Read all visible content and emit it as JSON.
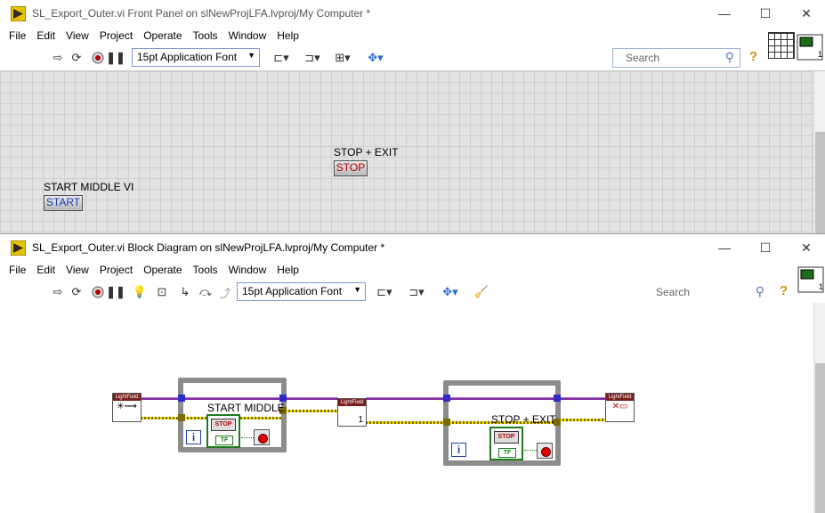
{
  "front_panel": {
    "title": "SL_Export_Outer.vi Front Panel on slNewProjLFA.lvproj/My Computer *",
    "menu": [
      "File",
      "Edit",
      "View",
      "Project",
      "Operate",
      "Tools",
      "Window",
      "Help"
    ],
    "font_select": "15pt Application Font",
    "search_placeholder": "Search",
    "controls": {
      "stop_exit_label": "STOP + EXIT",
      "stop_button_text": "STOP",
      "start_middle_label": "START MIDDLE VI",
      "start_button_text": "START"
    }
  },
  "block_diagram": {
    "title": "SL_Export_Outer.vi Block Diagram on slNewProjLFA.lvproj/My Computer *",
    "menu": [
      "File",
      "Edit",
      "View",
      "Project",
      "Operate",
      "Tools",
      "Window",
      "Help"
    ],
    "font_select": "15pt Application Font",
    "search_placeholder": "Search",
    "nodes": {
      "node_header": "LightField",
      "mid_node_value": "1",
      "loop1_label": "START MIDDLE",
      "loop2_label": "STOP + EXIT",
      "iteration_symbol": "i",
      "stop_text": "STOP",
      "tf_text": "TF",
      "connector_number": "1"
    }
  },
  "colors": {
    "wire_purple": "#7a2c9c",
    "wire_yellow": "#f4e400",
    "loop_border": "#8c8c8c",
    "bool_green": "#1c7c1c",
    "grid_bg": "#e2e2e2"
  }
}
